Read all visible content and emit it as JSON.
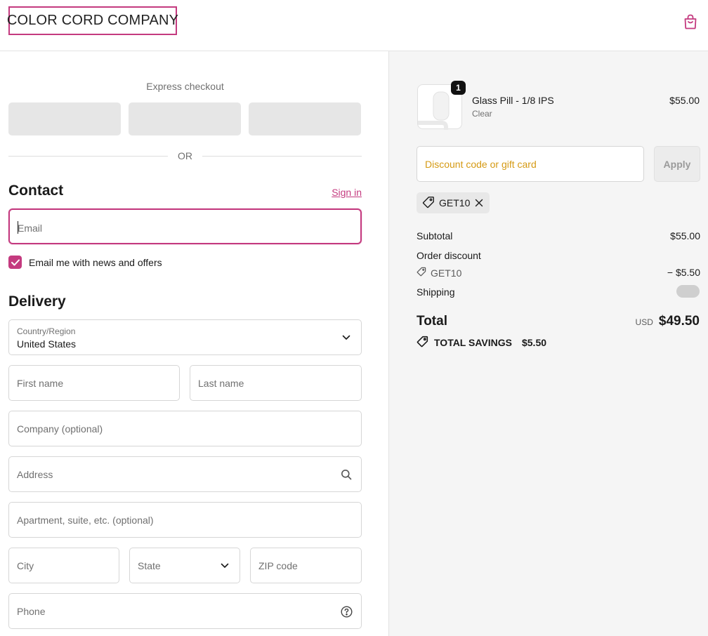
{
  "header": {
    "brand": "COLOR CORD COMPANY",
    "cart_icon": "shopping-bag-icon"
  },
  "express": {
    "label": "Express checkout",
    "buttons": [
      "",
      "",
      ""
    ],
    "divider": "OR"
  },
  "contact": {
    "title": "Contact",
    "sign_in": "Sign in",
    "email_placeholder": "Email",
    "email_value": "",
    "newsletter_label": "Email me with news and offers",
    "newsletter_checked": true
  },
  "delivery": {
    "title": "Delivery",
    "country_label": "Country/Region",
    "country_value": "United States",
    "first_name": "First name",
    "last_name": "Last name",
    "company": "Company (optional)",
    "address": "Address",
    "apartment": "Apartment, suite, etc. (optional)",
    "city": "City",
    "state": "State",
    "zip": "ZIP code",
    "phone": "Phone"
  },
  "summary": {
    "product": {
      "name": "Glass Pill - 1/8 IPS",
      "variant": "Clear",
      "price": "$55.00",
      "quantity": "1"
    },
    "discount_placeholder": "Discount code or gift card",
    "apply_label": "Apply",
    "applied_code": "GET10",
    "subtotal_label": "Subtotal",
    "subtotal_value": "$55.00",
    "order_discount_label": "Order discount",
    "discount_code": "GET10",
    "discount_value": "− $5.50",
    "shipping_label": "Shipping",
    "total_label": "Total",
    "currency": "USD",
    "total_value": "$49.50",
    "savings_label": "TOTAL SAVINGS",
    "savings_value": "$5.50"
  },
  "colors": {
    "accent": "#c43a7f",
    "discount_placeholder": "#d59a14",
    "summary_bg": "#f5f5f5"
  }
}
